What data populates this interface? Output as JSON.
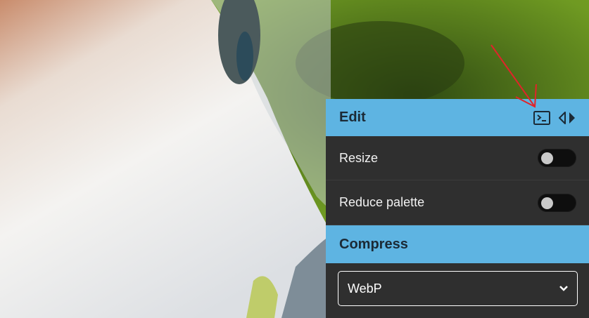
{
  "photo": {
    "description_icon": "photo-background-icon"
  },
  "edit": {
    "title": "Edit",
    "terminal_icon": "terminal-icon",
    "collapse_icon": "chevron-left-right-icon",
    "annotation_icon": "red-arrow-annotation-icon"
  },
  "options": [
    {
      "label": "Resize",
      "enabled": false
    },
    {
      "label": "Reduce palette",
      "enabled": false
    }
  ],
  "compress": {
    "title": "Compress",
    "format": "WebP"
  },
  "colors": {
    "accent": "#5eb4e2",
    "panel": "#2f2f2f",
    "arrow": "#e0242a"
  }
}
